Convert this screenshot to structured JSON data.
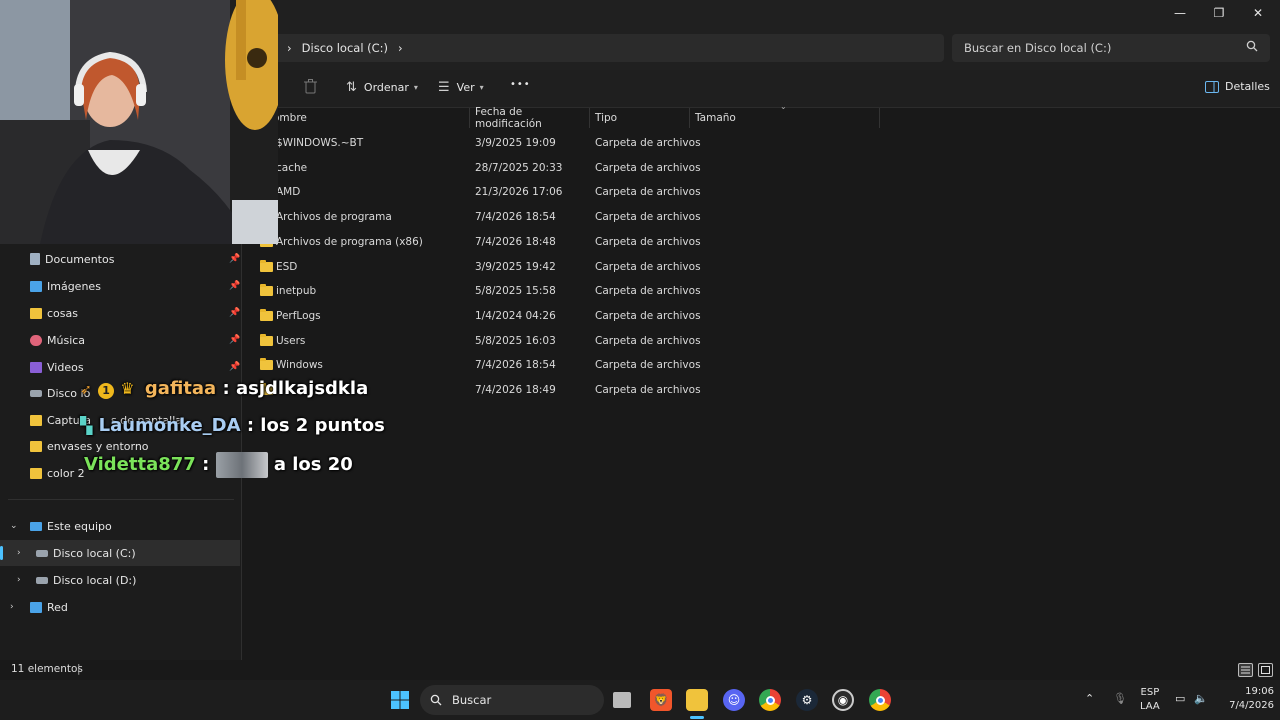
{
  "window": {
    "minimize_glyph": "—",
    "maximize_glyph": "❐",
    "close_glyph": "✕"
  },
  "address": {
    "crumb_partial": "o",
    "crumb_drive": "Disco local (C:)",
    "search_placeholder": "Buscar en Disco local (C:)"
  },
  "toolbar": {
    "sort_label": "Ordenar",
    "view_label": "Ver",
    "more_label": "•••",
    "details_label": "Detalles"
  },
  "columns": {
    "name": "ombre",
    "modified": "Fecha de modificación",
    "type": "Tipo",
    "size": "Tamaño"
  },
  "files": [
    {
      "name": "$WINDOWS.~BT",
      "modified": "3/9/2025 19:09",
      "type": "Carpeta de archivos"
    },
    {
      "name": "cache",
      "modified": "28/7/2025 20:33",
      "type": "Carpeta de archivos"
    },
    {
      "name": "AMD",
      "modified": "21/3/2026 17:06",
      "type": "Carpeta de archivos"
    },
    {
      "name": "Archivos de programa",
      "modified": "7/4/2026 18:54",
      "type": "Carpeta de archivos"
    },
    {
      "name": "Archivos de programa (x86)",
      "modified": "7/4/2026 18:48",
      "type": "Carpeta de archivos"
    },
    {
      "name": "ESD",
      "modified": "3/9/2025 19:42",
      "type": "Carpeta de archivos"
    },
    {
      "name": "inetpub",
      "modified": "5/8/2025 15:58",
      "type": "Carpeta de archivos"
    },
    {
      "name": "PerfLogs",
      "modified": "1/4/2024 04:26",
      "type": "Carpeta de archivos"
    },
    {
      "name": "Users",
      "modified": "5/8/2025 16:03",
      "type": "Carpeta de archivos"
    },
    {
      "name": "Windows",
      "modified": "7/4/2026 18:54",
      "type": "Carpeta de archivos"
    },
    {
      "name": "",
      "modified": "7/4/2026 18:49",
      "type": "Carpeta de archivos"
    }
  ],
  "nav": {
    "documentos": "Documentos",
    "imagenes": "Imágenes",
    "cosas": "cosas",
    "musica": "Música",
    "videos": "Videos",
    "disco_partial": "Disco lo",
    "capturas_a": "Captura",
    "capturas_b": "s de pantalla",
    "envases": "envases y entorno",
    "color2": "color 2",
    "este_equipo": "Este equipo",
    "disco_c": "Disco local (C:)",
    "disco_d": "Disco local (D:)",
    "red": "Red"
  },
  "status": {
    "count": "11 elementos"
  },
  "chat": [
    {
      "user": "gafitaa",
      "message": "asjdlkajsdkla",
      "color": "#f3b55b"
    },
    {
      "user": "Laumonke_DA",
      "message": "los 2 puntos",
      "color": "#a9cdf2"
    },
    {
      "user": "Videtta877",
      "message": "a los 20",
      "color": "#7be35a"
    }
  ],
  "taskbar": {
    "search_label": "Buscar",
    "lang_top": "ESP",
    "lang_bottom": "LAA",
    "time": "19:06",
    "date": "7/4/2026"
  }
}
